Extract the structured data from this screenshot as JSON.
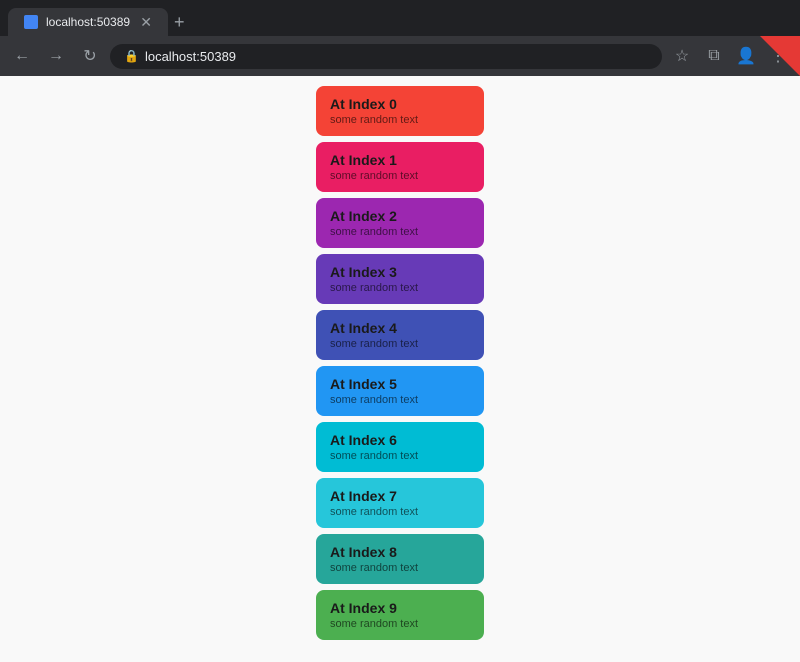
{
  "browser": {
    "tab_label": "localhost:50389",
    "address": "localhost:50389",
    "new_tab_symbol": "+",
    "back_symbol": "←",
    "forward_symbol": "→",
    "reload_symbol": "↻",
    "star_symbol": "☆",
    "account_symbol": "👤",
    "menu_symbol": "⋮",
    "tab_mode_symbol": "⧉"
  },
  "cards": [
    {
      "index": 0,
      "title": "At Index 0",
      "subtitle": "some random text",
      "color": "#f44336"
    },
    {
      "index": 1,
      "title": "At Index 1",
      "subtitle": "some random text",
      "color": "#e91e63"
    },
    {
      "index": 2,
      "title": "At Index 2",
      "subtitle": "some random text",
      "color": "#9c27b0"
    },
    {
      "index": 3,
      "title": "At Index 3",
      "subtitle": "some random text",
      "color": "#673ab7"
    },
    {
      "index": 4,
      "title": "At Index 4",
      "subtitle": "some random text",
      "color": "#3f51b5"
    },
    {
      "index": 5,
      "title": "At Index 5",
      "subtitle": "some random text",
      "color": "#2196f3"
    },
    {
      "index": 6,
      "title": "At Index 6",
      "subtitle": "some random text",
      "color": "#00bcd4"
    },
    {
      "index": 7,
      "title": "At Index 7",
      "subtitle": "some random text",
      "color": "#26c6da"
    },
    {
      "index": 8,
      "title": "At Index 8",
      "subtitle": "some random text",
      "color": "#26a69a"
    },
    {
      "index": 9,
      "title": "At Index 9",
      "subtitle": "some random text",
      "color": "#4caf50"
    }
  ]
}
